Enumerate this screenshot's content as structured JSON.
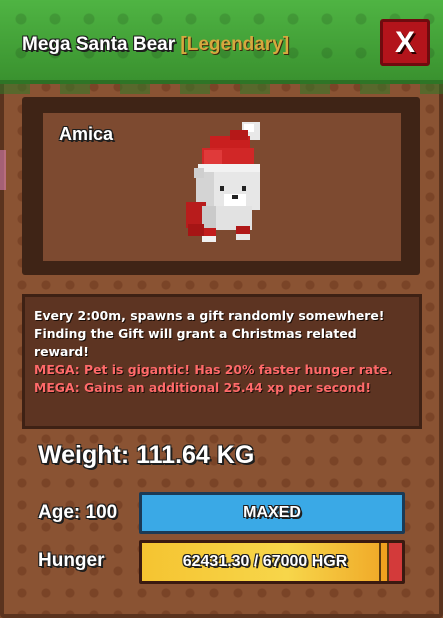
{
  "header": {
    "title": "Mega Santa Bear",
    "rarity": "[Legendary]",
    "close_label": "X"
  },
  "pet": {
    "name": "Amica"
  },
  "description": {
    "lines": [
      "Every 2:00m, spawns a gift randomly somewhere!",
      "Finding the Gift will grant a Christmas related",
      "reward!"
    ],
    "mega_lines": [
      "MEGA: Pet is gigantic! Has 20% faster hunger rate.",
      "MEGA: Gains an additional 25.44 xp per second!"
    ]
  },
  "stats": {
    "weight": "Weight: 111.64 KG",
    "age_label": "Age: 100",
    "age_bar_text": "MAXED",
    "hunger_label": "Hunger",
    "hunger_text": "62431.30 / 67000 HGR",
    "hunger_current": 62431.3,
    "hunger_max": 67000
  },
  "colors": {
    "rarity": "#d7a83e",
    "mega_text": "#ff6a6a",
    "age_bar": "#3aa9e6",
    "hunger_fill": "#f5c431",
    "hunger_empty": "#d33a3a",
    "close_button": "#b3141b",
    "header_grass": "#3f9e36"
  }
}
